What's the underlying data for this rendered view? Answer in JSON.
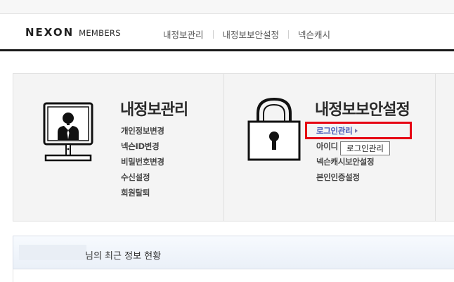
{
  "header": {
    "logo_primary": "NEXON",
    "logo_secondary": "MEMBERS",
    "nav": [
      "내정보관리",
      "내정보보안설정",
      "넥슨캐시"
    ]
  },
  "sections": {
    "my_info": {
      "title": "내정보관리",
      "icon": "monitor-user-icon",
      "links": [
        "개인정보변경",
        "넥슨ID변경",
        "비밀번호변경",
        "수신설정",
        "회원탈퇴"
      ]
    },
    "security": {
      "title": "내정보보안설정",
      "icon": "padlock-icon",
      "links": [
        "로그인관리",
        "아이디",
        "넥슨캐시보안설정",
        "본인인증설정"
      ]
    }
  },
  "tooltip": {
    "text": "로그인관리"
  },
  "status": {
    "text": "님의 최근 정보 현황"
  },
  "colors": {
    "active_link": "#4457b6",
    "highlight": "#e60012",
    "header_rule": "#1a1a1a"
  }
}
